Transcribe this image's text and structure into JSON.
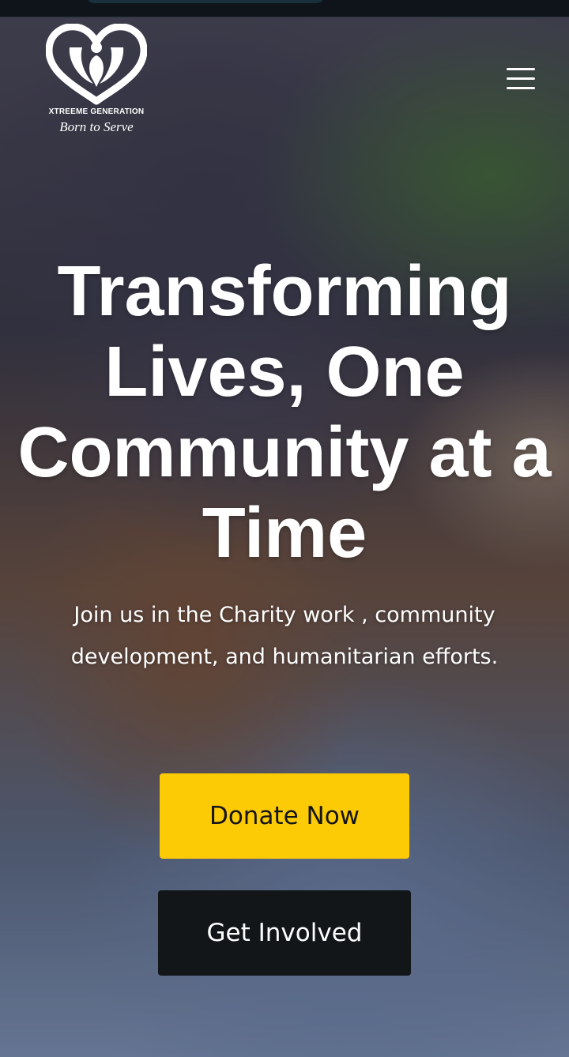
{
  "header": {
    "logo": {
      "icon": "heart-figure-logo-icon",
      "title": "XTREEME GENERATION",
      "tagline": "Born to Serve"
    },
    "menu_icon": "hamburger-menu-icon"
  },
  "hero": {
    "title": "Transforming Lives, One Community at a Time",
    "subtitle": "Join us in the Charity work , community development, and humanitarian efforts.",
    "buttons": {
      "donate_label": "Donate Now",
      "involved_label": "Get Involved"
    }
  },
  "colors": {
    "donate_button": "#fccb06",
    "involved_button": "#121619",
    "text": "#ffffff"
  }
}
